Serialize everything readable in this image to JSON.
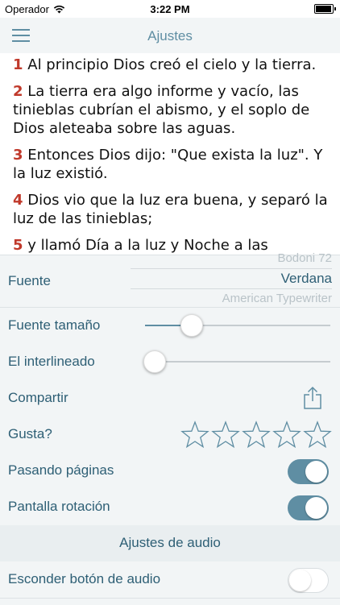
{
  "status": {
    "carrier": "Operador",
    "time": "3:22 PM"
  },
  "nav": {
    "title": "Ajustes",
    "menu_icon": "hamburger-icon"
  },
  "verses": [
    {
      "num": "1",
      "text": "Al principio Dios creó el cielo y la tierra."
    },
    {
      "num": "2",
      "text": "La tierra era algo informe y vacío, las tinieblas cubrían el abismo, y el soplo de Dios aleteaba sobre las aguas."
    },
    {
      "num": "3",
      "text": "Entonces Dios dijo: \"Que exista la luz\". Y la luz existió."
    },
    {
      "num": "4",
      "text": "Dios vio que la luz era buena, y separó la luz de las tinieblas;"
    },
    {
      "num": "5",
      "text": "y llamó Día a la luz y Noche a las tinieblas."
    }
  ],
  "settings": {
    "font": {
      "label": "Fuente",
      "options": [
        "Bodoni 72",
        "Verdana",
        "American Typewriter"
      ],
      "selected": "Verdana"
    },
    "font_size": {
      "label": "Fuente tamaño",
      "value": 0.25
    },
    "line_spacing": {
      "label": "El interlineado",
      "value": 0.05
    },
    "share": {
      "label": "Compartir",
      "icon": "share-icon"
    },
    "rate": {
      "label": "Gusta?",
      "stars": 5,
      "filled": 0
    },
    "page_turn": {
      "label": "Pasando páginas",
      "on": true
    },
    "rotation": {
      "label": "Pantalla rotación",
      "on": true
    },
    "audio_header": "Ajustes de audio",
    "hide_audio": {
      "label": "Esconder botón de audio",
      "on": false
    }
  },
  "colors": {
    "accent": "#5f8ea3",
    "verse_number": "#c0392b"
  }
}
